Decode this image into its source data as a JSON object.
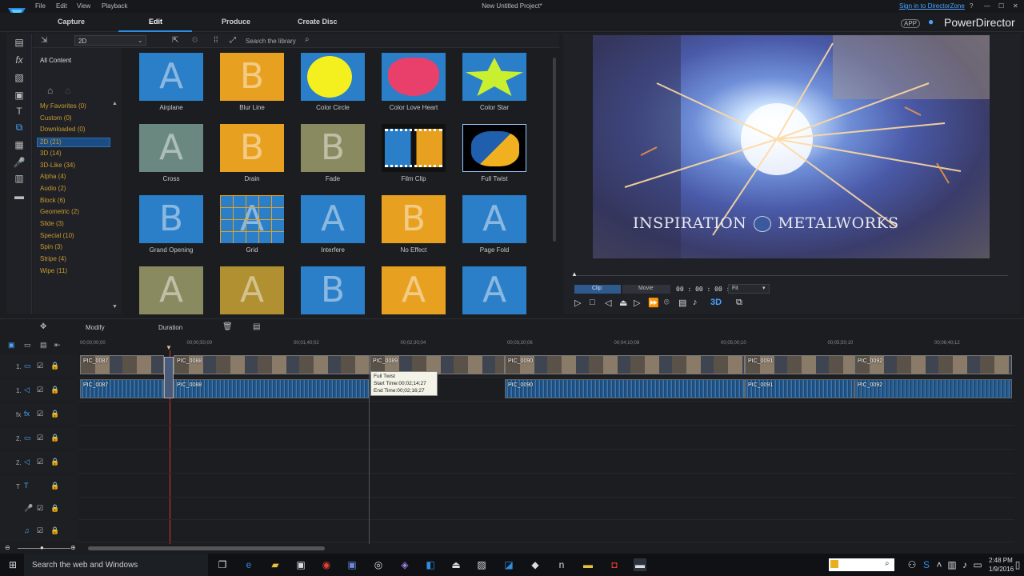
{
  "menu": {
    "file": "File",
    "edit": "Edit",
    "view": "View",
    "playback": "Playback"
  },
  "window_title": "New Untitled Project*",
  "signin": "Sign in to DirectorZone",
  "app_badge": "APP",
  "brand": "PowerDirector",
  "tabs": {
    "capture": "Capture",
    "edit": "Edit",
    "produce": "Produce",
    "create_disc": "Create Disc"
  },
  "library": {
    "filter_value": "2D",
    "search_placeholder": "Search the library",
    "all_content": "All Content",
    "categories": [
      "My Favorites  (0)",
      "Custom  (0)",
      "Downloaded  (0)",
      "2D  (21)",
      "3D  (14)",
      "3D-Like  (34)",
      "Alpha  (4)",
      "Audio  (2)",
      "Block  (6)",
      "Geometric  (2)",
      "Slide  (3)",
      "Special  (10)",
      "Spin  (3)",
      "Stripe  (4)",
      "Wipe  (11)"
    ],
    "tiles": [
      {
        "label": "Airplane",
        "bg": "#2a7fc8"
      },
      {
        "label": "Blur Line",
        "bg": "#e8a020"
      },
      {
        "label": "Color Circle",
        "bg": "#2a7fc8"
      },
      {
        "label": "Color Love Heart",
        "bg": "#2a7fc8"
      },
      {
        "label": "Color Star",
        "bg": "#2a7fc8"
      },
      {
        "label": "Cross",
        "bg": "#6a8880"
      },
      {
        "label": "Drain",
        "bg": "#e8a020"
      },
      {
        "label": "Fade",
        "bg": "#8a8a60"
      },
      {
        "label": "Film Clip",
        "bg": "#111"
      },
      {
        "label": "Full Twist",
        "bg": "#000"
      },
      {
        "label": "Grand Opening",
        "bg": "#2a7fc8"
      },
      {
        "label": "Grid",
        "bg": "#2a7fc8"
      },
      {
        "label": "Interfere",
        "bg": "#2a7fc8"
      },
      {
        "label": "No Effect",
        "bg": "#e8a020"
      },
      {
        "label": "Page Fold",
        "bg": "#2a7fc8"
      },
      {
        "label": "",
        "bg": "#8a8a60"
      },
      {
        "label": "",
        "bg": "#b09030"
      },
      {
        "label": "",
        "bg": "#2a7fc8"
      },
      {
        "label": "",
        "bg": "#e8a020"
      },
      {
        "label": "",
        "bg": "#2a7fc8"
      }
    ]
  },
  "preview": {
    "overlay_text_left": "INSPIRATION",
    "overlay_text_right": "METALWORKS",
    "clip_tab": "Clip",
    "movie_tab": "Movie",
    "timecode": "00 : 00 : 00 : 00",
    "fit": "Fit"
  },
  "timeline": {
    "modify": "Modify",
    "duration": "Duration",
    "ruler": [
      "00;00;00;00",
      "00;00;50;00",
      "00;01;40;02",
      "00;02;30;04",
      "00;03;20;06",
      "00;04;10;08",
      "00;05;00;10",
      "00;05;50;10",
      "00;06;40;12"
    ],
    "track_labels": [
      "1.",
      "1.",
      "fx",
      "2.",
      "2.",
      "T",
      "",
      ""
    ],
    "video_clips": [
      "PIC_0087",
      "PIC_0088",
      "PIC_0089",
      "PIC_0090",
      "PIC_0091",
      "PIC_0092"
    ],
    "audio_clips": [
      "PIC_0087",
      "PIC_0088",
      "PIC_0090",
      "PIC_0091",
      "PIC_0092"
    ],
    "tooltip": {
      "title": "Full Twist",
      "start": "Start Time:00;02;14;27",
      "end": "End Time:00;02;16;27"
    }
  },
  "taskbar": {
    "search": "Search the web and Windows",
    "time": "2:48 PM",
    "date": "1/9/2016"
  }
}
